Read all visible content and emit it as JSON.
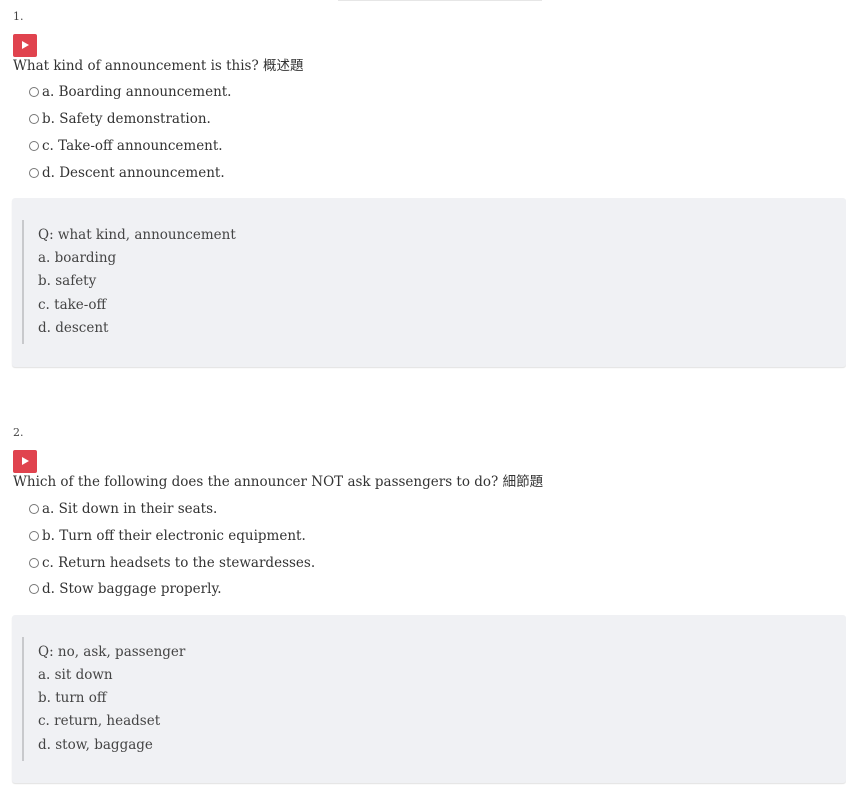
{
  "questions": [
    {
      "number": "1.",
      "text": "What kind of announcement is this? 概述題",
      "options": [
        "a. Boarding announcement.",
        "b. Safety demonstration.",
        "c. Take-off announcement.",
        "d. Descent announcement."
      ],
      "notes": [
        "Q: what kind, announcement",
        "a. boarding",
        "b. safety",
        "c. take-off",
        "d. descent"
      ]
    },
    {
      "number": "2.",
      "text": "Which of the following does the announcer NOT ask passengers to do? 細節題",
      "options": [
        "a. Sit down in their seats.",
        "b. Turn off their electronic equipment.",
        "c. Return headsets to the stewardesses.",
        "d. Stow baggage properly."
      ],
      "notes": [
        "Q: no, ask, passenger",
        "a. sit down",
        "b. turn off",
        "c. return, headset",
        "d. stow, baggage"
      ]
    }
  ],
  "colors": {
    "play_button": "#e0434e",
    "note_background": "#f0f1f4",
    "text": "#333333"
  },
  "icons": {
    "play": "play-icon",
    "radio": "radio-unchecked-icon"
  }
}
